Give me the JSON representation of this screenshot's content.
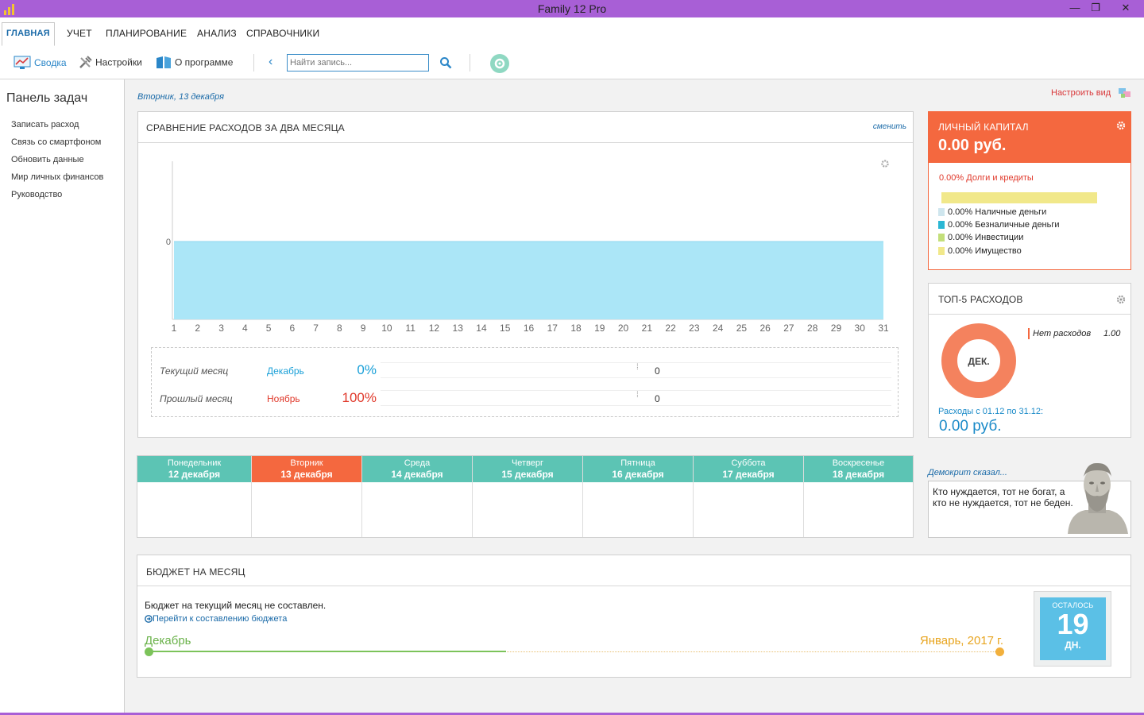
{
  "window": {
    "title": "Family 12 Pro",
    "minimize": "—",
    "restore": "❐",
    "close": "✕"
  },
  "menu": {
    "items": [
      "ГЛАВНАЯ",
      "УЧЕТ",
      "ПЛАНИРОВАНИЕ",
      "АНАЛИЗ",
      "СПРАВОЧНИКИ"
    ]
  },
  "toolbar": {
    "summary": "Сводка",
    "settings": "Настройки",
    "about": "О программе",
    "search_placeholder": "Найти запись..."
  },
  "sidebar": {
    "title": "Панель задач",
    "tasks": [
      "Записать расход",
      "Связь со смартфоном",
      "Обновить данные",
      "Мир личных финансов",
      "Руководство"
    ]
  },
  "main": {
    "date": "Вторник, 13 декабря",
    "customize": "Настроить вид"
  },
  "comparison": {
    "title": "СРАВНЕНИЕ РАСХОДОВ ЗА ДВА МЕСЯЦА",
    "change_link": "сменить",
    "rows": [
      {
        "label": "Текущий месяц",
        "month": "Декабрь",
        "percent": "0%",
        "value": "0",
        "color": "#1aa0d8"
      },
      {
        "label": "Прошлый месяц",
        "month": "Ноябрь",
        "percent": "100%",
        "value": "0",
        "color": "#e0392b"
      }
    ]
  },
  "chart_data": {
    "type": "area",
    "x": [
      1,
      2,
      3,
      4,
      5,
      6,
      7,
      8,
      9,
      10,
      11,
      12,
      13,
      14,
      15,
      16,
      17,
      18,
      19,
      20,
      21,
      22,
      23,
      24,
      25,
      26,
      27,
      28,
      29,
      30,
      31
    ],
    "series": [
      {
        "values": [
          0,
          0,
          0,
          0,
          0,
          0,
          0,
          0,
          0,
          0,
          0,
          0,
          0,
          0,
          0,
          0,
          0,
          0,
          0,
          0,
          0,
          0,
          0,
          0,
          0,
          0,
          0,
          0,
          0,
          0,
          0
        ],
        "color": "#abe6f7"
      }
    ],
    "yticks": [
      "0"
    ],
    "fill": "#abe6f7"
  },
  "capital": {
    "title": "ЛИЧНЫЙ КАПИТАЛ",
    "value": "0.00 руб.",
    "debts": "0.00% Долги и кредиты",
    "legend": [
      {
        "label": "0.00% Наличные деньги",
        "color": "#cfe6ee"
      },
      {
        "label": "0.00% Безналичные деньги",
        "color": "#2bb7d4"
      },
      {
        "label": "0.00% Инвестиции",
        "color": "#c3df7a"
      },
      {
        "label": "0.00% Имущество",
        "color": "#f1e88a"
      }
    ],
    "bar_color": "#f1e88a"
  },
  "top5": {
    "title": "ТОП-5 РАСХОДОВ",
    "donut_label": "ДЕК.",
    "item_label": "Нет расходов",
    "item_value": "1.00",
    "period": "Расходы с 01.12 по 31.12:",
    "total": "0.00 руб.",
    "color": "#f4825e"
  },
  "week": {
    "days": [
      {
        "name": "Понедельник",
        "date": "12 декабря",
        "today": false
      },
      {
        "name": "Вторник",
        "date": "13 декабря",
        "today": true
      },
      {
        "name": "Среда",
        "date": "14 декабря",
        "today": false
      },
      {
        "name": "Четверг",
        "date": "15 декабря",
        "today": false
      },
      {
        "name": "Пятница",
        "date": "16 декабря",
        "today": false
      },
      {
        "name": "Суббота",
        "date": "17 декабря",
        "today": false
      },
      {
        "name": "Воскресенье",
        "date": "18 декабря",
        "today": false
      }
    ]
  },
  "quote": {
    "author": "Демокрит сказал...",
    "text": "Кто нуждается, тот не богат, а кто не нуждается, тот не беден."
  },
  "budget": {
    "title": "БЮДЖЕТ НА МЕСЯЦ",
    "message": "Бюджет на текущий месяц не составлен.",
    "link": "Перейти к составлению бюджета",
    "start": "Декабрь",
    "end": "Январь, 2017 г.",
    "progress": 0.42,
    "remaining_label": "ОСТАЛОСЬ",
    "remaining_days": "19",
    "remaining_unit": "ДН."
  }
}
